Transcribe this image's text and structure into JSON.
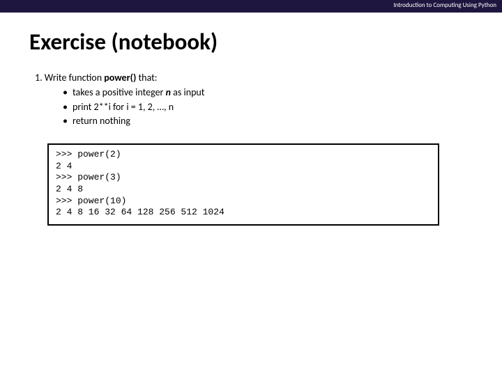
{
  "header": {
    "subtitle": "Introduction to Computing Using Python"
  },
  "title": "Exercise (notebook)",
  "instruction": {
    "lead_prefix": "1. Write function ",
    "func_name": "power()",
    "lead_suffix": " that:",
    "bullets": [
      {
        "prefix": "takes a positive integer ",
        "emph": "n",
        "suffix": " as input"
      },
      {
        "text": "print 2**i for i = 1, 2, …, n"
      },
      {
        "text": "return nothing"
      }
    ]
  },
  "code": {
    "lines": [
      ">>> power(2)",
      "2 4",
      ">>> power(3)",
      "2 4 8",
      ">>> power(10)",
      "2 4 8 16 32 64 128 256 512 1024"
    ]
  }
}
